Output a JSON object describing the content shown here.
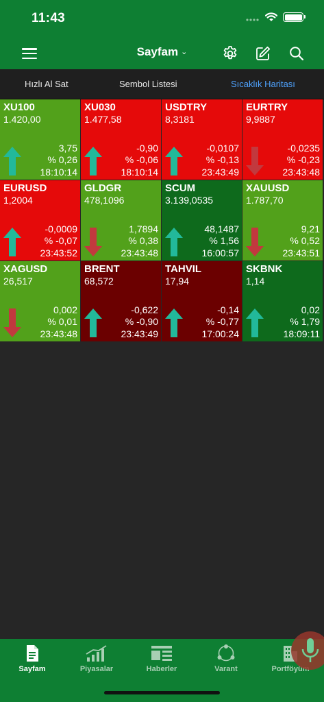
{
  "status": {
    "time": "11:43"
  },
  "header": {
    "title": "Sayfam",
    "icons": [
      "menu-icon",
      "chevron-down-icon",
      "gear-icon",
      "edit-icon",
      "search-icon"
    ]
  },
  "tabs": [
    {
      "label": "Hızlı Al Sat",
      "active": false
    },
    {
      "label": "Sembol Listesi",
      "active": false
    },
    {
      "label": "Sıcaklık Haritası",
      "active": true
    }
  ],
  "colors": {
    "brand_green": "#0e7f33",
    "tab_active": "#4fa3ff",
    "up_arrow": "#22b99a",
    "down_arrow": "#c2393e",
    "tile_light_green": "#52a11b",
    "tile_dark_green": "#0e6a1c",
    "tile_red": "#e50a0a",
    "tile_dark_red": "#6b0000"
  },
  "tiles": [
    {
      "symbol": "XU100",
      "price": "1.420,00",
      "change": "3,75",
      "percent": "% 0,26",
      "time": "18:10:14",
      "direction": "up",
      "color": "#52a11b"
    },
    {
      "symbol": "XU030",
      "price": "1.477,58",
      "change": "-0,90",
      "percent": "% -0,06",
      "time": "18:10:14",
      "direction": "up",
      "color": "#e50a0a"
    },
    {
      "symbol": "USDTRY",
      "price": "8,3181",
      "change": "-0,0107",
      "percent": "% -0,13",
      "time": "23:43:49",
      "direction": "up",
      "color": "#e50a0a"
    },
    {
      "symbol": "EURTRY",
      "price": "9,9887",
      "change": "-0,0235",
      "percent": "% -0,23",
      "time": "23:43:48",
      "direction": "down",
      "color": "#e50a0a"
    },
    {
      "symbol": "EURUSD",
      "price": "1,2004",
      "change": "-0,0009",
      "percent": "% -0,07",
      "time": "23:43:52",
      "direction": "up",
      "color": "#e50a0a"
    },
    {
      "symbol": "GLDGR",
      "price": "478,1096",
      "change": "1,7894",
      "percent": "% 0,38",
      "time": "23:43:48",
      "direction": "down",
      "color": "#52a11b"
    },
    {
      "symbol": "SCUM",
      "price": "3.139,0535",
      "change": "48,1487",
      "percent": "% 1,56",
      "time": "16:00:57",
      "direction": "up",
      "color": "#0e6a1c"
    },
    {
      "symbol": "XAUUSD",
      "price": "1.787,70",
      "change": "9,21",
      "percent": "% 0,52",
      "time": "23:43:51",
      "direction": "down",
      "color": "#52a11b"
    },
    {
      "symbol": "XAGUSD",
      "price": "26,517",
      "change": "0,002",
      "percent": "% 0,01",
      "time": "23:43:48",
      "direction": "down",
      "color": "#52a11b"
    },
    {
      "symbol": "BRENT",
      "price": "68,572",
      "change": "-0,622",
      "percent": "% -0,90",
      "time": "23:43:49",
      "direction": "up",
      "color": "#6b0000"
    },
    {
      "symbol": "TAHVIL",
      "price": "17,94",
      "change": "-0,14",
      "percent": "% -0,77",
      "time": "17:00:24",
      "direction": "up",
      "color": "#6b0000"
    },
    {
      "symbol": "SKBNK",
      "price": "1,14",
      "change": "0,02",
      "percent": "% 1,79",
      "time": "18:09:11",
      "direction": "up",
      "color": "#0e6a1c"
    }
  ],
  "bottom_nav": [
    {
      "label": "Sayfam",
      "icon": "document-icon",
      "active": true
    },
    {
      "label": "Piyasalar",
      "icon": "bar-chart-icon",
      "active": false
    },
    {
      "label": "Haberler",
      "icon": "news-icon",
      "active": false
    },
    {
      "label": "Varant",
      "icon": "share-nodes-icon",
      "active": false
    },
    {
      "label": "Portföyüm",
      "icon": "building-icon",
      "active": false
    }
  ]
}
